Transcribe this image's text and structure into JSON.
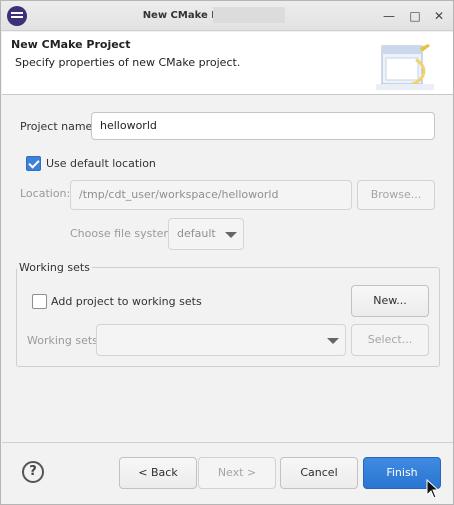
{
  "window": {
    "title": "New CMake Project",
    "controls": {
      "minimize": "—",
      "maximize": "□",
      "close": "✕"
    }
  },
  "header": {
    "title": "New CMake Project",
    "description": "Specify properties of new CMake project."
  },
  "form": {
    "project_name_label": "Project name:",
    "project_name_value": "helloworld",
    "use_default_location_label": "Use default location",
    "use_default_location_checked": true,
    "location_label": "Location:",
    "location_value": "/tmp/cdt_user/workspace/helloworld",
    "browse_label": "Browse...",
    "file_system_label": "Choose file system:",
    "file_system_value": "default"
  },
  "working_sets": {
    "group_title": "Working sets",
    "add_label": "Add project to working sets",
    "add_checked": false,
    "new_label": "New...",
    "sets_label": "Working sets:",
    "sets_value": "",
    "select_label": "Select..."
  },
  "footer": {
    "help_label": "?",
    "back_label": "< Back",
    "next_label": "Next >",
    "cancel_label": "Cancel",
    "finish_label": "Finish"
  },
  "colors": {
    "accent": "#2a75d0",
    "checkbox_checked": "#3b82d8",
    "titlebar": "#e6e6e6"
  }
}
